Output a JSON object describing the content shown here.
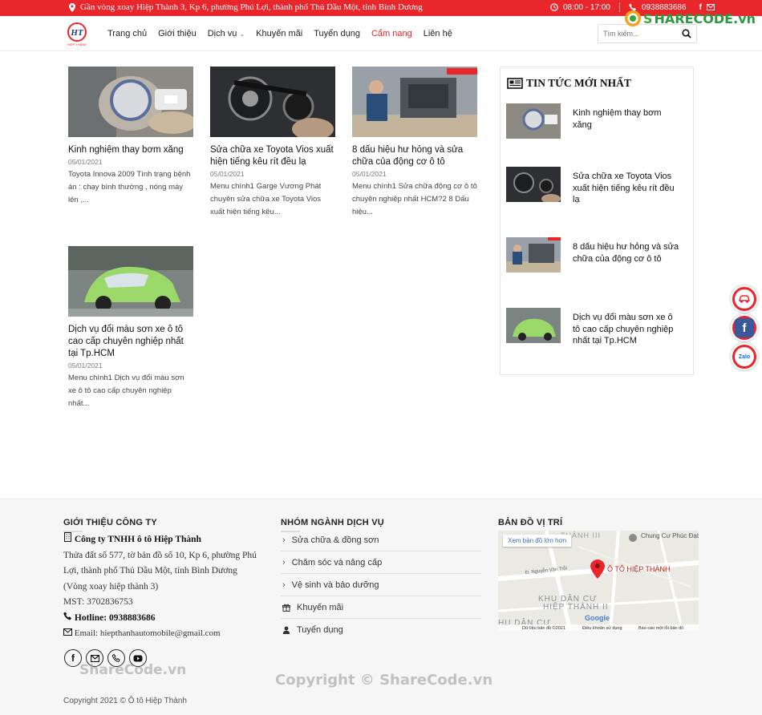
{
  "topbar": {
    "address": "Gần vòng xoay Hiệp Thành 3, Kp 6, phường Phú Lợi, thành phố Thủ Dầu Một, tỉnh Bình Dương",
    "hours": "08:00 - 17:00",
    "phone": "0938883686"
  },
  "logo": {
    "text": "HIỆP THÀNH"
  },
  "watermark_logo": {
    "prefix": "S",
    "text": "HARECODE.vn"
  },
  "nav": {
    "items": [
      "Trang chủ",
      "Giới thiệu",
      "Dịch vụ",
      "Khuyến mãi",
      "Tuyển dụng",
      "Cẩm nang",
      "Liên hệ"
    ],
    "active": "Cẩm nang"
  },
  "search": {
    "placeholder": "Tìm kiếm..."
  },
  "posts": [
    {
      "title": "Kinh nghiệm thay bơm xăng",
      "date": "05/01/2021",
      "excerpt": "Toyota Innova 2009 Tình trạng bệnh án : chạy bình thường , nóng máy lên ,..."
    },
    {
      "title": "Sửa chữa xe Toyota Vios xuất hiện tiếng kêu rít đều lạ",
      "date": "05/01/2021",
      "excerpt": "Menu chính1 Garge Vương Phát chuyên sửa chữa xe Toyota Vios xuất hiện tiếng kêu..."
    },
    {
      "title": "8 dấu hiệu hư hỏng và sửa chữa của động cơ ô tô",
      "date": "05/01/2021",
      "excerpt": "Menu chính1 Sửa chữa động cơ ô tô chuyên nghiệp nhất HCM?2 8 Dấu hiệu..."
    },
    {
      "title": "Dịch vụ đổi màu sơn xe ô tô cao cấp chuyên nghiệp nhất tại Tp.HCM",
      "date": "05/01/2021",
      "excerpt": "Menu chính1 Dịch vụ đổi màu sơn xe ô tô cao cấp chuyên nghiệp nhất..."
    }
  ],
  "sidebar": {
    "heading": "TIN TỨC MỚI NHẤT",
    "items": [
      "Kinh nghiệm thay bơm xăng",
      "Sửa chữa xe Toyota Vios xuất hiện tiếng kêu rít đều lạ",
      "8 dấu hiệu hư hỏng và sửa chữa của động cơ ô tô",
      "Dịch vụ đổi màu sơn xe ô tô cao cấp chuyên nghiệp nhất tại Tp.HCM"
    ]
  },
  "footer": {
    "intro_title": "GIỚI THIỆU CÔNG TY",
    "company": "Công ty TNHH ô tô Hiệp Thành",
    "address": "Thửa đất số 577, tờ bản đồ số 10, Kp 6, phường Phú Lợi, thành phố Thủ Dầu Một, tỉnh Bình Dương (Vòng xoay hiệp thành 3)",
    "mst": "MST: 3702836753",
    "hotline": "Hotline: 0938883686",
    "email": "Email: hiepthanhautomobile@gmail.com",
    "services_title": "NHÓM NGÀNH DỊCH VỤ",
    "services": [
      {
        "label": "Sửa chữa & đồng sơn",
        "icon": "chevron-right-icon"
      },
      {
        "label": "Chăm sóc và nâng cấp",
        "icon": "chevron-right-icon"
      },
      {
        "label": "Vệ sinh và bảo dưỡng",
        "icon": "chevron-right-icon"
      },
      {
        "label": "Khuyến mãi",
        "icon": "gift-icon"
      },
      {
        "label": "Tuyển dụng",
        "icon": "user-icon"
      }
    ],
    "map_title": "BẢN ĐỒ VỊ TRÍ",
    "map": {
      "button": "Xem bản đồ lớn hơn",
      "pin_label": "Ô TÔ HIỆP THÀNH",
      "place": "Chung Cư Phúc Đạt Connect",
      "area1": "KHU DÂN CƯ",
      "area2": "HIỆP THÀNH II",
      "area_top": "THÀNH III",
      "area_bottom": "HU DÂN CƯ",
      "street": "Đ. Nguyễn Văn Trỗi",
      "google": "Google",
      "attr1": "Dữ liệu bản đồ ©2021",
      "attr2": "Điều khoản sử dụng",
      "attr3": "Báo cáo một lỗi bản đồ"
    },
    "copyright": "Copyright 2021 © Ô tô Hiệp Thành"
  },
  "watermarks": [
    "ShareCode.vn",
    "Copyright © ShareCode.vn"
  ],
  "colors": {
    "brand_red": "#e8262b",
    "facebook_blue": "#3b5998"
  }
}
